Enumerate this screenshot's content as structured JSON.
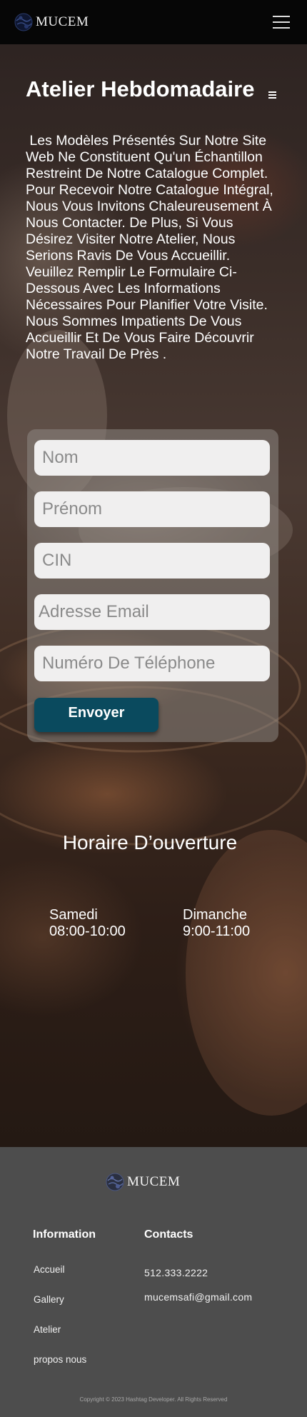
{
  "header": {
    "logo_text": "MUCEM",
    "logo_icon": "globe-logo-icon",
    "menu_icon": "hamburger-menu-icon"
  },
  "hero": {
    "title": "Atelier Hebdomadaire",
    "paragraph": " Les Modèles Présentés Sur Notre Site\nWeb Ne Constituent Qu'un Échantillon\nRestreint De Notre Catalogue Complet.\nPour Recevoir Notre Catalogue Intégral,\nNous Vous Invitons Chaleureusement À\nNous Contacter. De Plus, Si Vous\nDésirez Visiter Notre Atelier, Nous\nSerions Ravis De Vous Accueillir.\nVeuillez Remplir Le Formulaire Ci-\nDessous Avec Les Informations\nNécessaires Pour Planifier Votre Visite.\nNous Sommes Impatients De Vous\nAccueillir Et De Vous Faire Découvrir\nNotre Travail De Près ."
  },
  "form": {
    "nom_placeholder": "Nom",
    "prenom_placeholder": "Prénom",
    "cin_placeholder": "CIN",
    "email_placeholder": "Adresse Email",
    "phone_placeholder": "Numéro De Téléphone",
    "submit_label": "Envoyer",
    "button_color": "#0a4a5e"
  },
  "hours": {
    "title": "Horaire D’ouverture",
    "days": [
      {
        "day": "Samedi",
        "time": "08:00-10:00"
      },
      {
        "day": "Dimanche",
        "time": "9:00-11:00"
      }
    ]
  },
  "footer": {
    "logo_text": "MUCEM",
    "info_heading": "Information",
    "contacts_heading": "Contacts",
    "links": [
      "Accueil",
      "Gallery",
      "Atelier",
      "propos nous"
    ],
    "phone": "512.333.2222",
    "email": "mucemsafi@gmail.com",
    "copyright": "Copyright © 2023 Hashtag Developer. All Rights Reserved",
    "background": "#4d4d4d"
  }
}
